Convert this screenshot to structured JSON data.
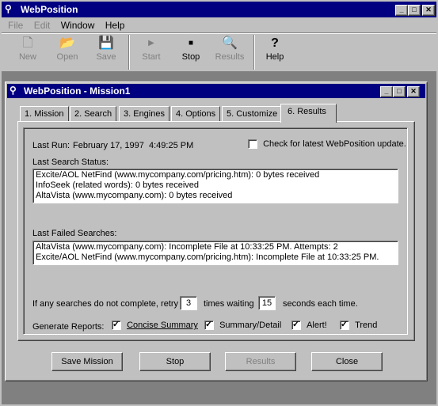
{
  "app": {
    "title": "WebPosition",
    "menu": [
      "File",
      "Edit",
      "Window",
      "Help"
    ],
    "toolbar": {
      "new": "New",
      "open": "Open",
      "save": "Save",
      "start": "Start",
      "stop": "Stop",
      "results": "Results",
      "help": "Help"
    }
  },
  "child": {
    "title": "WebPosition - Mission1",
    "tabs": [
      "1. Mission",
      "2. Search",
      "3. Engines",
      "4. Options",
      "5. Customize",
      "6. Results"
    ],
    "active_tab": "6. Results"
  },
  "results": {
    "last_run_label": "Last Run:",
    "last_run_value": "February 17, 1997  4:49:25 PM",
    "check_update_label": "Check for latest WebPosition update.",
    "check_update_checked": false,
    "last_search_status_label": "Last Search Status:",
    "last_search_status": [
      "Excite/AOL NetFind (www.mycompany.com/pricing.htm): 0 bytes received",
      "InfoSeek (related words): 0 bytes received",
      "AltaVista (www.mycompany.com): 0 bytes received"
    ],
    "last_failed_label": "Last Failed Searches:",
    "last_failed": [
      "AltaVista (www.mycompany.com): Incomplete File at 10:33:25 PM. Attempts: 2",
      "Excite/AOL NetFind (www.mycompany.com/pricing.htm): Incomplete File at 10:33:25 PM."
    ],
    "retry_prefix": "If any searches do not complete, retry",
    "retry_value": "3",
    "retry_mid": "times waiting",
    "wait_value": "15",
    "retry_suffix": "seconds each time.",
    "generate_reports_label": "Generate Reports:",
    "reports": {
      "concise": "Concise Summary",
      "summary_detail": "Summary/Detail",
      "alert": "Alert!",
      "trend": "Trend"
    }
  },
  "buttons": {
    "save_mission": "Save Mission",
    "stop": "Stop",
    "results": "Results",
    "close": "Close"
  },
  "colors": {
    "titlebar": "#000080",
    "face": "#c0c0c0",
    "disabled": "#808080"
  }
}
